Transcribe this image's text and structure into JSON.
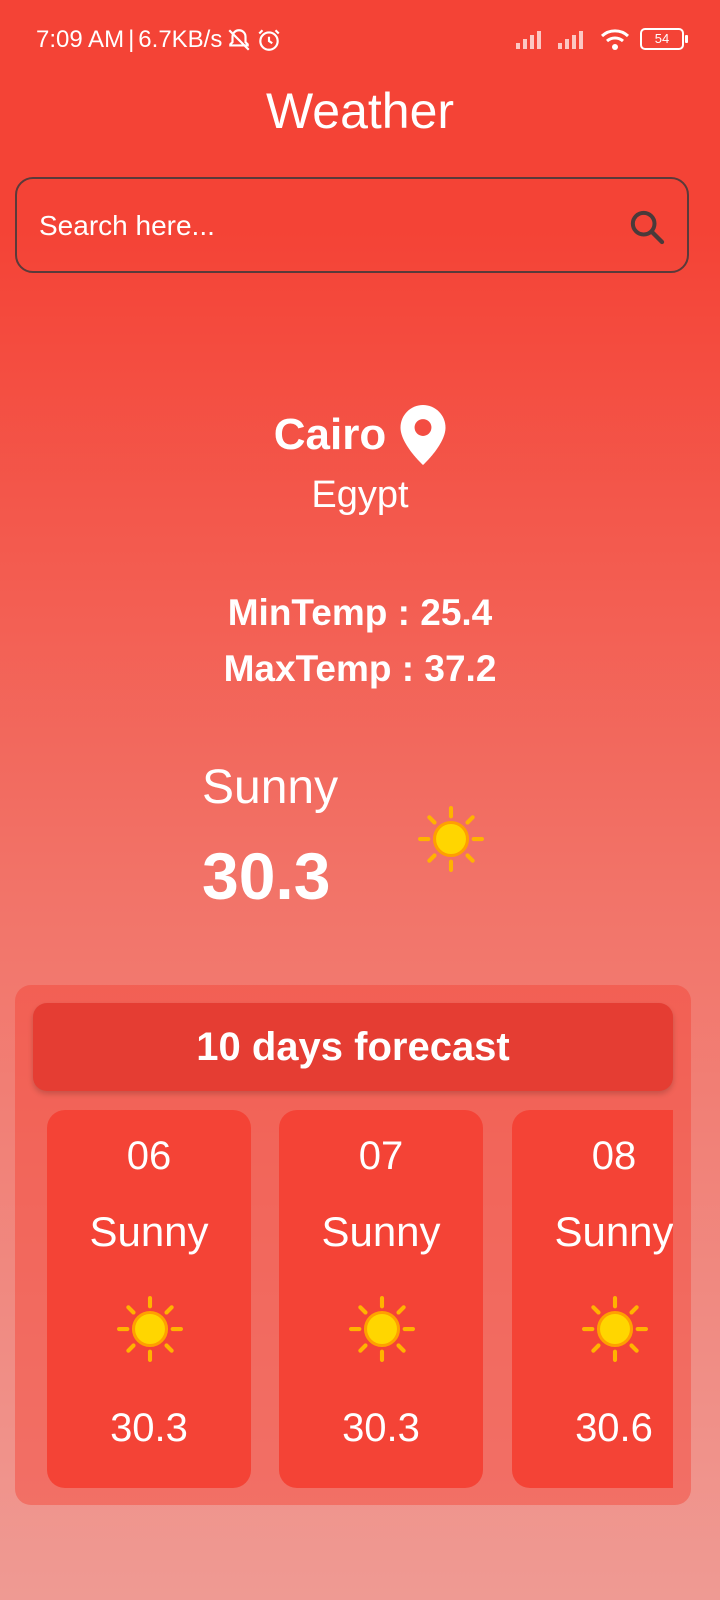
{
  "status_bar": {
    "time": "7:09 AM",
    "speed": "6.7KB/s",
    "battery": "54"
  },
  "app": {
    "title": "Weather"
  },
  "search": {
    "placeholder": "Search here..."
  },
  "location": {
    "city": "Cairo",
    "country": "Egypt"
  },
  "temps": {
    "min": "MinTemp : 25.4",
    "max": "MaxTemp : 37.2"
  },
  "current": {
    "condition": "Sunny",
    "temp": "30.3"
  },
  "forecast": {
    "title": "10 days forecast",
    "days": [
      {
        "day": "06",
        "condition": "Sunny",
        "temp": "30.3"
      },
      {
        "day": "07",
        "condition": "Sunny",
        "temp": "30.3"
      },
      {
        "day": "08",
        "condition": "Sunny",
        "temp": "30.6"
      }
    ]
  },
  "colors": {
    "primary": "#f44336",
    "header": "#e53d33",
    "sun": "#ffd600"
  }
}
